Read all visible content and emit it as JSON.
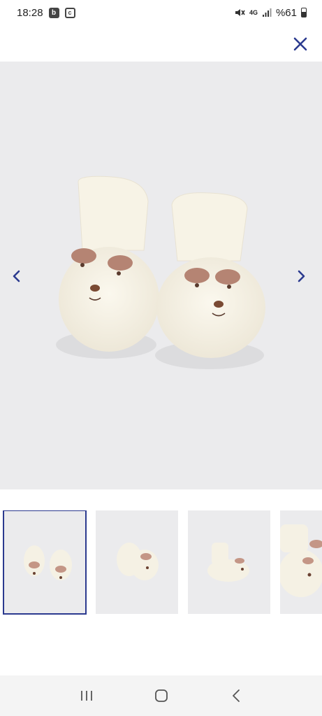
{
  "status_bar": {
    "time": "18:28",
    "notification_icons": [
      "b-icon",
      "c-icon"
    ],
    "network_label": "4G",
    "battery_label": "%61"
  },
  "header": {
    "close_icon": "close-icon",
    "accent_color": "#2b3a8f"
  },
  "gallery": {
    "current_index": 1,
    "image_count": 4,
    "image_subject": "cream fleece bear baby booties",
    "prev_icon": "chevron-left-icon",
    "next_icon": "chevron-right-icon"
  },
  "thumbnails": [
    {
      "view": "front pair",
      "selected": true
    },
    {
      "view": "angled pair",
      "selected": false
    },
    {
      "view": "side single",
      "selected": false
    },
    {
      "view": "close-up pair",
      "selected": false
    }
  ],
  "system_nav": {
    "recents_icon": "recents-icon",
    "home_icon": "home-icon",
    "back_icon": "back-icon"
  }
}
